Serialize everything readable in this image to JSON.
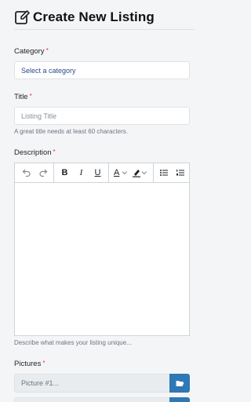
{
  "header": {
    "title": "Create New Listing",
    "icon": "edit-icon"
  },
  "category": {
    "label": "Category",
    "required_mark": "*",
    "placeholder": "Select a category"
  },
  "title_field": {
    "label": "Title",
    "required_mark": "*",
    "placeholder": "Listing Title",
    "help": "A great title needs at least 60 characters."
  },
  "description": {
    "label": "Description",
    "required_mark": "*",
    "help": "Describe what makes your listing unique...",
    "toolbar": {
      "bold": "B",
      "italic": "I",
      "underline": "U",
      "font_color": "A"
    }
  },
  "pictures": {
    "label": "Pictures",
    "required_mark": "*",
    "placeholder": "Picture #1..."
  },
  "colors": {
    "accent": "#2f77b5",
    "required": "#dc3545"
  }
}
